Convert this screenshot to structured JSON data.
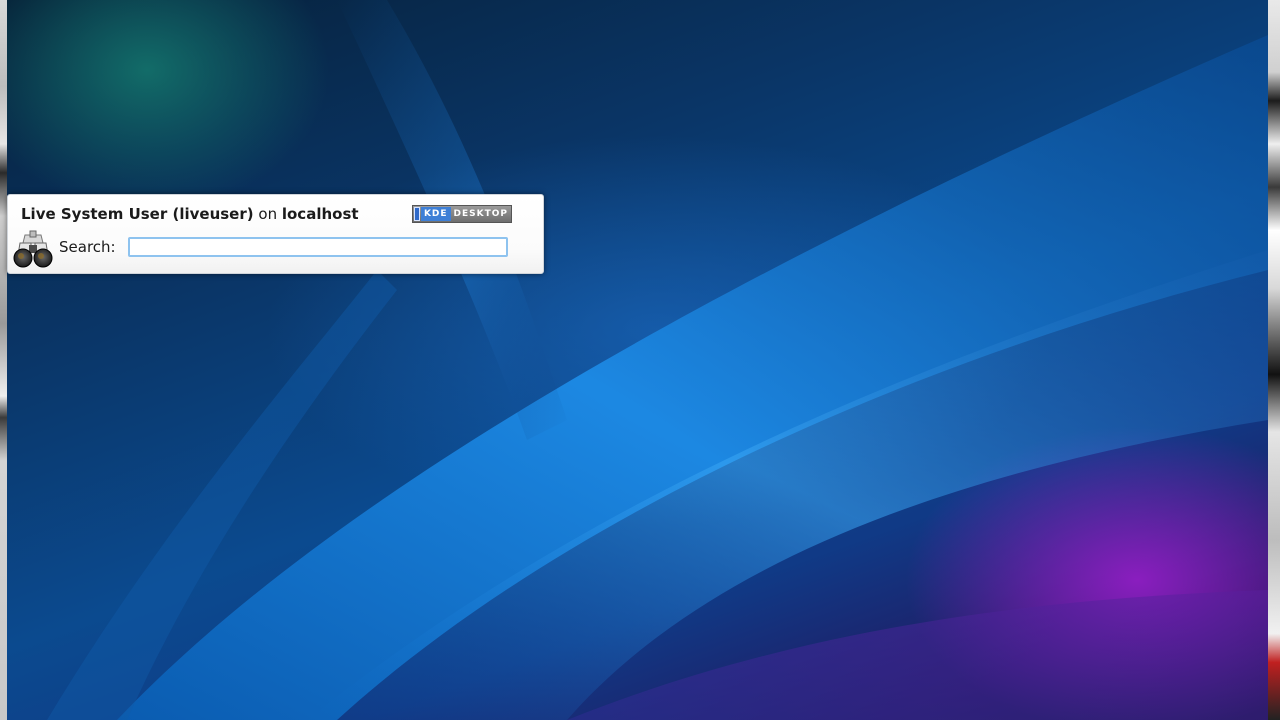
{
  "krunner": {
    "user_full_name": "Live System User (liveuser)",
    "on_word": "on",
    "host": "localhost",
    "badge_kde": "KDE",
    "badge_desktop": "DESKTOP",
    "search_label": "Search:",
    "search_value": "",
    "search_placeholder": "",
    "icon": "binoculars-icon"
  },
  "colors": {
    "input_focus_border": "#8ec3ef",
    "kde_blue": "#3e7fd6"
  }
}
